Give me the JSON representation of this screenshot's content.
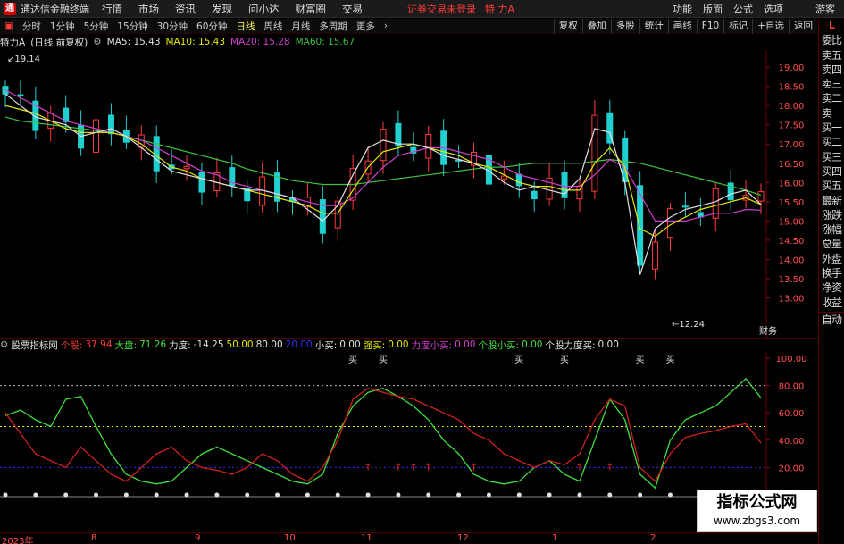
{
  "titlebar": {
    "app_title": "通达信金融终端",
    "menus": [
      "行情",
      "市场",
      "资讯",
      "发现",
      "问小达",
      "财富圈",
      "交易"
    ],
    "notice": "证券交易未登录",
    "stock": "特 力A",
    "right_menus": [
      "功能",
      "版面",
      "公式",
      "选项"
    ],
    "guest": "游客"
  },
  "toolbar": {
    "periods": [
      "分时",
      "1分钟",
      "5分钟",
      "15分钟",
      "30分钟",
      "60分钟",
      "日线",
      "周线",
      "月线",
      "多周期",
      "更多"
    ],
    "active": "日线",
    "right_buttons": [
      "复权",
      "叠加",
      "多股",
      "统计",
      "画线",
      "F10",
      "标记",
      "+自选",
      "返回"
    ]
  },
  "ma_header": {
    "name": "特力A",
    "mode": "(日线 前复权)",
    "items": [
      {
        "label": "MA5: 15.43",
        "color": "#e0e0e0"
      },
      {
        "label": "MA10: 15.43",
        "color": "#e8e800"
      },
      {
        "label": "MA20: 15.28",
        "color": "#d040d0"
      },
      {
        "label": "MA60: 15.67",
        "color": "#40c040"
      }
    ]
  },
  "price_axis": {
    "ticks": [
      "19.00",
      "18.50",
      "18.00",
      "17.50",
      "17.00",
      "16.50",
      "16.00",
      "15.50",
      "15.00",
      "14.50",
      "14.00",
      "13.50",
      "13.00"
    ],
    "high_label": "19.14",
    "low_label": "12.24",
    "corner": "财务"
  },
  "sub_header": {
    "name": "股票指标网",
    "items": [
      {
        "label": "个股:",
        "value": "37.94",
        "color": "#ff3b3b"
      },
      {
        "label": "大盘:",
        "value": "71.26",
        "color": "#40e040"
      },
      {
        "label": "力度:",
        "value": "-14.25",
        "color": "#e0e0e0"
      },
      {
        "label": "",
        "value": "50.00",
        "color": "#e8e800"
      },
      {
        "label": "",
        "value": "80.00",
        "color": "#e0e0e0"
      },
      {
        "label": "",
        "value": "20.00",
        "color": "#3030ff"
      },
      {
        "label": "小买:",
        "value": "0.00",
        "color": "#e0e0e0"
      },
      {
        "label": "强买:",
        "value": "0.00",
        "color": "#e8e800"
      },
      {
        "label": "力度小买:",
        "value": "0.00",
        "color": "#d040d0"
      },
      {
        "label": "个股小买:",
        "value": "0.00",
        "color": "#40e040"
      },
      {
        "label": "个股力度买:",
        "value": "0.00",
        "color": "#e0e0e0"
      }
    ]
  },
  "sub_axis": {
    "ticks": [
      "100.00",
      "80.00",
      "60.00",
      "40.00",
      "20.00"
    ]
  },
  "buy_labels": [
    "买",
    "买",
    "买",
    "买",
    "买",
    "买"
  ],
  "date_axis": [
    "2023年",
    "8",
    "9",
    "10",
    "11",
    "12",
    "1",
    "2"
  ],
  "side_panel": [
    "委比",
    "卖五",
    "卖四",
    "卖三",
    "卖二",
    "卖一",
    "买一",
    "买二",
    "买三",
    "买四",
    "买五",
    "最新",
    "涨跌",
    "涨幅",
    "总量",
    "外盘",
    "换手",
    "净资",
    "收益",
    "自动"
  ],
  "watermark": {
    "title": "指标公式网",
    "url": "www.zbgs3.com"
  },
  "colors": {
    "up": "#ff3b3b",
    "down": "#20d0d0",
    "ma5": "#e0e0e0",
    "ma10": "#e8e800",
    "ma20": "#d040d0",
    "ma60": "#40c040"
  },
  "chart_data": {
    "type": "line",
    "title": "特力A 日线",
    "y_range": [
      12.24,
      19.14
    ],
    "ma5": [
      18.3,
      18.0,
      17.7,
      17.6,
      17.5,
      17.2,
      17.3,
      17.4,
      17.2,
      16.9,
      16.6,
      16.3,
      16.2,
      16.1,
      16.0,
      15.9,
      15.8,
      15.8,
      15.7,
      15.6,
      15.3,
      15.0,
      15.4,
      16.2,
      16.9,
      17.1,
      17.0,
      17.0,
      16.9,
      16.7,
      16.6,
      16.5,
      16.3,
      16.0,
      15.8,
      15.9,
      15.8,
      15.7,
      16.1,
      17.4,
      17.3,
      16.0,
      13.6,
      14.8,
      15.1,
      15.3,
      15.4,
      15.5,
      15.7,
      15.8,
      15.43
    ],
    "ma10": [
      18.0,
      17.9,
      17.8,
      17.6,
      17.4,
      17.3,
      17.3,
      17.3,
      17.2,
      17.0,
      16.7,
      16.4,
      16.3,
      16.1,
      16.0,
      15.9,
      15.8,
      15.7,
      15.6,
      15.5,
      15.4,
      15.2,
      15.2,
      15.8,
      16.4,
      16.8,
      16.9,
      17.0,
      16.9,
      16.8,
      16.7,
      16.5,
      16.4,
      16.2,
      16.0,
      15.9,
      15.9,
      15.8,
      15.8,
      16.5,
      16.9,
      16.4,
      14.8,
      14.6,
      14.9,
      15.1,
      15.3,
      15.4,
      15.5,
      15.6,
      15.43
    ],
    "ma20": [
      18.4,
      18.2,
      18.0,
      17.8,
      17.6,
      17.5,
      17.4,
      17.3,
      17.2,
      17.1,
      16.9,
      16.7,
      16.5,
      16.3,
      16.2,
      16.0,
      15.9,
      15.8,
      15.7,
      15.6,
      15.5,
      15.4,
      15.4,
      15.6,
      16.0,
      16.4,
      16.7,
      16.8,
      16.9,
      16.9,
      16.8,
      16.7,
      16.6,
      16.4,
      16.2,
      16.1,
      16.0,
      15.9,
      15.9,
      16.2,
      16.6,
      16.4,
      15.7,
      15.0,
      15.0,
      15.0,
      15.1,
      15.2,
      15.2,
      15.3,
      15.28
    ],
    "ma60": [
      17.7,
      17.6,
      17.55,
      17.5,
      17.45,
      17.4,
      17.35,
      17.3,
      17.2,
      17.1,
      17.0,
      16.9,
      16.8,
      16.7,
      16.6,
      16.5,
      16.35,
      16.25,
      16.15,
      16.05,
      16.0,
      15.95,
      15.95,
      15.95,
      16.0,
      16.05,
      16.1,
      16.15,
      16.2,
      16.25,
      16.3,
      16.35,
      16.4,
      16.4,
      16.45,
      16.5,
      16.5,
      16.5,
      16.5,
      16.55,
      16.6,
      16.55,
      16.5,
      16.4,
      16.3,
      16.2,
      16.1,
      16.0,
      15.9,
      15.8,
      15.67
    ],
    "indicator_stock": [
      60,
      45,
      30,
      25,
      20,
      35,
      25,
      15,
      10,
      20,
      30,
      35,
      25,
      20,
      18,
      15,
      20,
      30,
      25,
      15,
      10,
      20,
      40,
      70,
      78,
      75,
      72,
      70,
      65,
      60,
      55,
      45,
      40,
      30,
      25,
      20,
      25,
      22,
      30,
      55,
      70,
      65,
      20,
      10,
      30,
      42,
      45,
      47,
      50,
      52,
      38
    ],
    "indicator_market": [
      58,
      62,
      55,
      50,
      70,
      72,
      50,
      30,
      15,
      10,
      8,
      10,
      20,
      30,
      35,
      30,
      25,
      20,
      15,
      10,
      8,
      15,
      45,
      65,
      75,
      78,
      72,
      65,
      55,
      40,
      30,
      15,
      10,
      8,
      10,
      20,
      25,
      15,
      10,
      40,
      70,
      55,
      15,
      5,
      40,
      55,
      60,
      65,
      75,
      85,
      71
    ]
  }
}
